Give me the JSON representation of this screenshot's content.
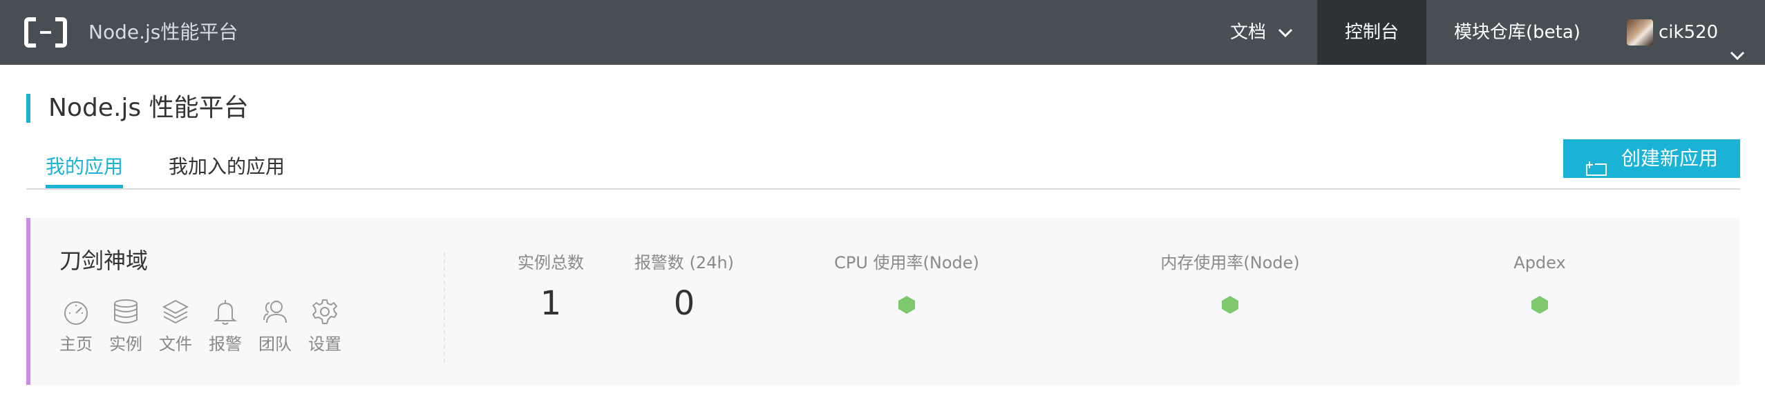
{
  "topbar": {
    "brand": "Node.js性能平台",
    "nav": {
      "docs": "文档",
      "console": "控制台",
      "repo": "模块仓库(beta)",
      "user": "cik520"
    }
  },
  "page": {
    "title": "Node.js 性能平台"
  },
  "tabs": {
    "mine": "我的应用",
    "joined": "我加入的应用"
  },
  "create_button": "创建新应用",
  "app": {
    "name": "刀剑神域",
    "actions": [
      "主页",
      "实例",
      "文件",
      "报警",
      "团队",
      "设置"
    ],
    "metrics": {
      "instances_label": "实例总数",
      "instances_value": "1",
      "alerts_label": "报警数 (24h)",
      "alerts_value": "0",
      "cpu_label": "CPU 使用率(Node)",
      "memory_label": "内存使用率(Node)",
      "apdex_label": "Apdex"
    },
    "status_color": "#7ec86e",
    "accent_color": "#c98ce8"
  },
  "colors": {
    "brand_accent": "#1ab3d6",
    "topbar_bg": "#474e54"
  }
}
